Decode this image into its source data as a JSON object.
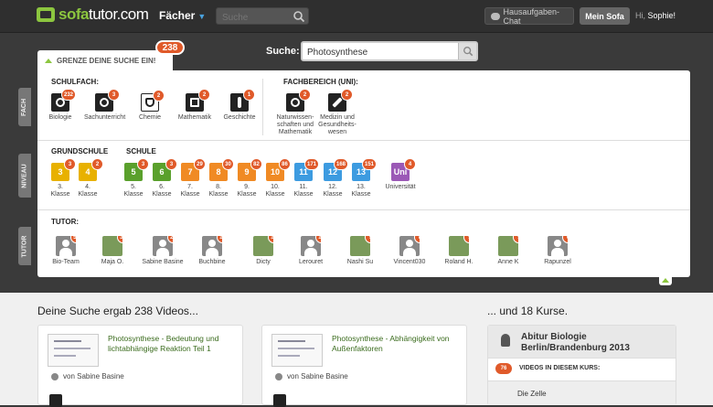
{
  "topbar": {
    "logo_brand": "sofa",
    "logo_rest": "tutor.com",
    "faecher_label": "Fächer",
    "search_placeholder": "Suche",
    "chat_label": "Hausaufgaben-Chat",
    "mein_sofa_label": "Mein Sofa",
    "greeting_prefix": "Hi,",
    "user_name": "Sophie!"
  },
  "search": {
    "label": "Suche:",
    "value": "Photosynthese"
  },
  "filter": {
    "tab_label": "GRENZE DEINE SUCHE EIN!",
    "total_count": "238",
    "fach_tab": "FACH",
    "niveau_tab": "NIVEAU",
    "tutor_tab": "TUTOR",
    "schulfach_label": "SCHULFACH:",
    "fachbereich_label": "FACHBEREICH (UNI):",
    "grundschule_label": "GRUNDSCHULE",
    "schule_label": "SCHULE",
    "tutor_label": "TUTOR:",
    "schulfach": [
      {
        "label": "Biologie",
        "count": "232"
      },
      {
        "label": "Sachunterricht",
        "count": "3"
      },
      {
        "label": "Chemie",
        "count": "2"
      },
      {
        "label": "Mathematik",
        "count": "2"
      },
      {
        "label": "Geschichte",
        "count": "1"
      }
    ],
    "fachbereich": [
      {
        "label": "Naturwissen-\nschaften und\nMathematik",
        "count": "2"
      },
      {
        "label": "Medizin und\nGesundheits-\nwesen",
        "count": "2"
      }
    ],
    "grundschule": [
      {
        "num": "3",
        "label": "3.\nKlasse",
        "count": "3",
        "color": "#e8b100"
      },
      {
        "num": "4",
        "label": "4.\nKlasse",
        "count": "2",
        "color": "#e8b100"
      }
    ],
    "schule": [
      {
        "num": "5",
        "label": "5.\nKlasse",
        "count": "3",
        "color": "#5aa02c"
      },
      {
        "num": "6",
        "label": "6.\nKlasse",
        "count": "3",
        "color": "#5aa02c"
      },
      {
        "num": "7",
        "label": "7.\nKlasse",
        "count": "29",
        "color": "#f08a24"
      },
      {
        "num": "8",
        "label": "8.\nKlasse",
        "count": "30",
        "color": "#f08a24"
      },
      {
        "num": "9",
        "label": "9.\nKlasse",
        "count": "82",
        "color": "#f08a24"
      },
      {
        "num": "10",
        "label": "10.\nKlasse",
        "count": "86",
        "color": "#f08a24"
      },
      {
        "num": "11",
        "label": "11.\nKlasse",
        "count": "171",
        "color": "#3d9be0"
      },
      {
        "num": "12",
        "label": "12.\nKlasse",
        "count": "168",
        "color": "#3d9be0"
      },
      {
        "num": "13",
        "label": "13.\nKlasse",
        "count": "151",
        "color": "#3d9be0"
      }
    ],
    "uni": {
      "num": "Uni",
      "label": "Universität",
      "count": "4",
      "color": "#9b59b6"
    },
    "tutors": [
      {
        "name": "Bio-Team",
        "count": "54"
      },
      {
        "name": "Maja O.",
        "count": "33"
      },
      {
        "name": "Sabine Basine",
        "count": "26"
      },
      {
        "name": "Buchbine",
        "count": "19"
      },
      {
        "name": "Dicty",
        "count": "12"
      },
      {
        "name": "Lerouret",
        "count": "10"
      },
      {
        "name": "Nashi Su",
        "count": "9"
      },
      {
        "name": "Vincent030",
        "count": "8"
      },
      {
        "name": "Roland H.",
        "count": "7"
      },
      {
        "name": "Anne K",
        "count": "7"
      },
      {
        "name": "Rapunzel",
        "count": "6"
      }
    ]
  },
  "results": {
    "videos_heading": "Deine Suche ergab 238 Videos...",
    "courses_heading": "... und 18 Kurse.",
    "videos": [
      {
        "title": "Photosynthese - Bedeutung und lichtabhängige Reaktion Teil 1",
        "author": "von Sabine Basine"
      },
      {
        "title": "Photosynthese - Abhängigkeit von Außenfaktoren",
        "author": "von Sabine Basine"
      }
    ],
    "course": {
      "title": "Abitur Biologie\nBerlin/Brandenburg 2013",
      "video_count": "76",
      "videos_label": "VIDEOS IN DIESEM KURS:",
      "first_chapter": "Die Zelle"
    }
  }
}
